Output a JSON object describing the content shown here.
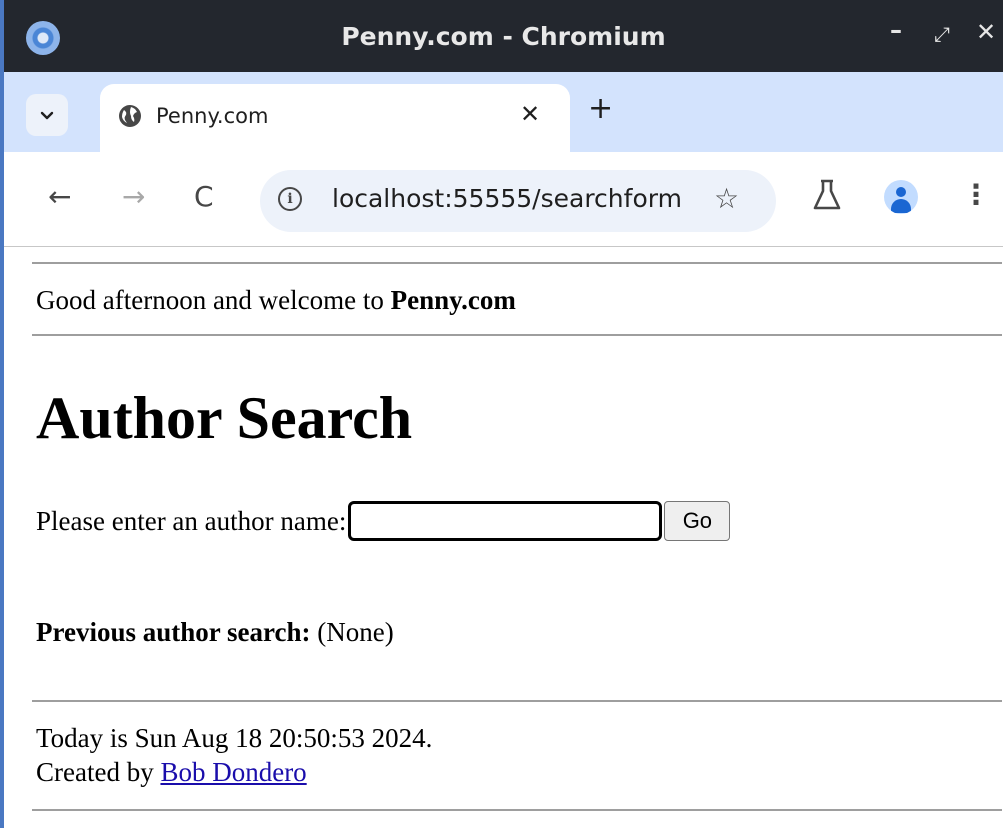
{
  "window": {
    "title": "Penny.com - Chromium",
    "controls": {
      "minimize": "–",
      "maximize": "⤢",
      "close": "✕"
    }
  },
  "tabs": {
    "list_icon": "chevron-down-icon",
    "active": {
      "title": "Penny.com",
      "close": "✕",
      "icon": "globe-icon"
    },
    "new_tab": "+"
  },
  "toolbar": {
    "back": "←",
    "forward": "→",
    "reload": "C",
    "site_info": "i",
    "url": "localhost:55555/searchform",
    "bookmark": "☆",
    "menu": "⋮"
  },
  "page": {
    "greeting_prefix": "Good afternoon and welcome to ",
    "greeting_site": "Penny.com",
    "heading": "Author Search",
    "prompt_label": "Please enter an author name:",
    "search_value": "",
    "go_label": "Go",
    "previous_label": "Previous author search:",
    "previous_value": " (None)",
    "date_text": "Today is Sun Aug 18 20:50:53 2024.",
    "created_by_prefix": "Created by ",
    "author_link": "Bob Dondero"
  }
}
